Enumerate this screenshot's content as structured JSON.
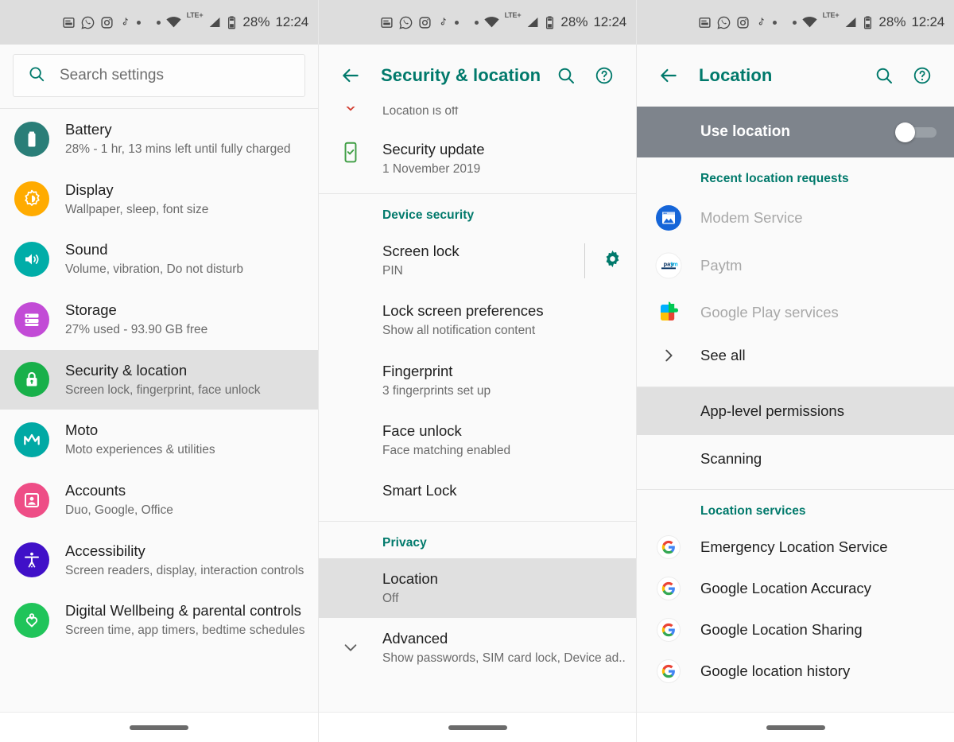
{
  "status_bar": {
    "icons": [
      "notification-icon",
      "whatsapp-icon",
      "instagram-icon",
      "tiktok-icon",
      "dot-icon",
      "dot-icon",
      "wifi-icon",
      "signal-icon",
      "battery-icon"
    ],
    "network_label": "LTE+",
    "battery_percent": "28%",
    "time": "12:24"
  },
  "colors": {
    "accent_teal": "#00796b",
    "selected_row": "#e0e0e0",
    "use_location_bar": "#7e848c",
    "battery_icon": "#2a7e78",
    "display_icon": "#ffab00",
    "sound_icon": "#00ada8",
    "storage_icon": "#c martin",
    "security_icon": "#18b04a",
    "moto_icon": "#00a9a4",
    "accounts_icon": "#ee4d86",
    "accessibility_icon": "#4010c8",
    "wellbeing_icon": "#20c45a"
  },
  "settings_panel": {
    "search": {
      "placeholder": "Search settings",
      "icon": "search-icon"
    },
    "items": [
      {
        "title": "Battery",
        "subtitle": "28% - 1 hr, 13 mins left until fully charged",
        "icon": "battery-icon",
        "selected": false
      },
      {
        "title": "Display",
        "subtitle": "Wallpaper, sleep, font size",
        "icon": "brightness-icon",
        "selected": false
      },
      {
        "title": "Sound",
        "subtitle": "Volume, vibration, Do not disturb",
        "icon": "volume-icon",
        "selected": false
      },
      {
        "title": "Storage",
        "subtitle": "27% used - 93.90 GB free",
        "icon": "storage-icon",
        "selected": false
      },
      {
        "title": "Security & location",
        "subtitle": "Screen lock, fingerprint, face unlock",
        "icon": "lock-icon",
        "selected": true
      },
      {
        "title": "Moto",
        "subtitle": "Moto experiences & utilities",
        "icon": "moto-icon",
        "selected": false
      },
      {
        "title": "Accounts",
        "subtitle": "Duo, Google, Office",
        "icon": "account-icon",
        "selected": false
      },
      {
        "title": "Accessibility",
        "subtitle": "Screen readers, display, interaction controls",
        "icon": "accessibility-icon",
        "selected": false
      },
      {
        "title": "Digital Wellbeing & parental controls",
        "subtitle": "Screen time, app timers, bedtime schedules",
        "icon": "wellbeing-icon",
        "selected": false
      }
    ]
  },
  "security_panel": {
    "appbar": {
      "back": "back-arrow-icon",
      "title": "Security & location",
      "search": "search-icon",
      "help": "help-icon"
    },
    "partial_row": {
      "title": "Location is off",
      "icon": "chevron-down-red-icon"
    },
    "security_update": {
      "title": "Security update",
      "subtitle": "1 November 2019",
      "icon": "security-update-icon"
    },
    "device_security_header": "Device security",
    "device_security_items": [
      {
        "title": "Screen lock",
        "subtitle": "PIN",
        "action_icon": "gear-icon",
        "has_action": true
      },
      {
        "title": "Lock screen preferences",
        "subtitle": "Show all notification content",
        "has_action": false
      },
      {
        "title": "Fingerprint",
        "subtitle": "3 fingerprints set up",
        "has_action": false
      },
      {
        "title": "Face unlock",
        "subtitle": "Face matching enabled",
        "has_action": false
      },
      {
        "title": "Smart Lock",
        "subtitle": "",
        "has_action": false
      }
    ],
    "privacy_header": "Privacy",
    "privacy_items": [
      {
        "title": "Location",
        "subtitle": "Off",
        "selected": true
      },
      {
        "title": "Advanced",
        "subtitle": "Show passwords, SIM card lock, Device ad..",
        "icon": "chevron-down-icon",
        "selected": false
      }
    ]
  },
  "location_panel": {
    "appbar": {
      "back": "back-arrow-icon",
      "title": "Location",
      "search": "search-icon",
      "help": "help-icon"
    },
    "use_location": {
      "label": "Use location",
      "state": "off"
    },
    "recent_header": "Recent location requests",
    "recent_items": [
      {
        "name": "Modem Service",
        "icon": "modem-service-icon"
      },
      {
        "name": "Paytm",
        "icon": "paytm-icon"
      },
      {
        "name": "Google Play services",
        "icon": "play-services-icon"
      }
    ],
    "see_all": {
      "label": "See all",
      "icon": "chevron-right-icon"
    },
    "menu_items": [
      {
        "label": "App-level permissions",
        "selected": true
      },
      {
        "label": "Scanning",
        "selected": false
      }
    ],
    "services_header": "Location services",
    "services": [
      {
        "label": "Emergency Location Service",
        "icon": "google-icon"
      },
      {
        "label": "Google Location Accuracy",
        "icon": "google-icon"
      },
      {
        "label": "Google Location Sharing",
        "icon": "google-icon"
      },
      {
        "label": "Google location history",
        "icon": "google-icon"
      }
    ]
  }
}
